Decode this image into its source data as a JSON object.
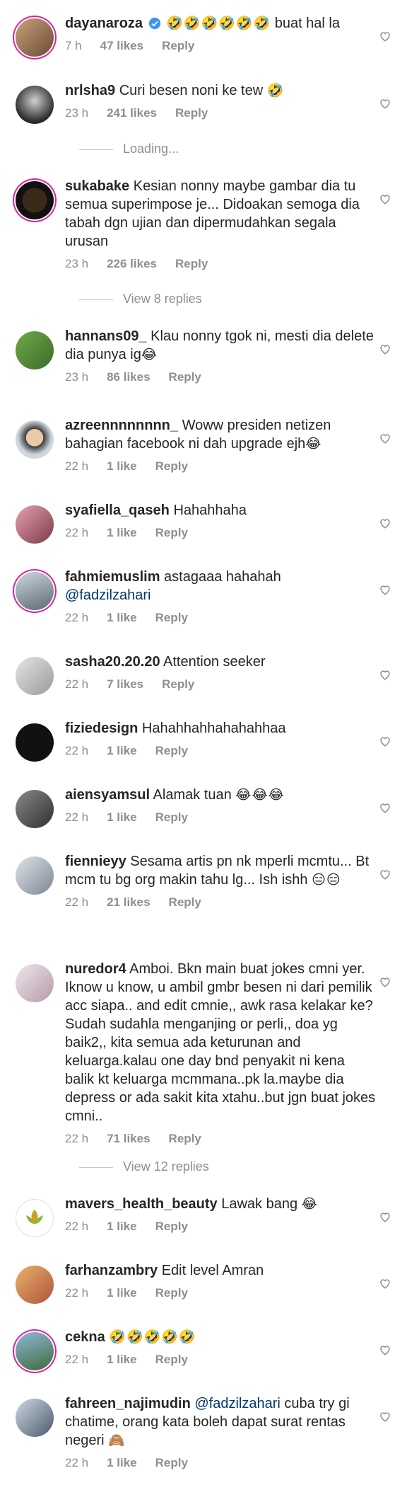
{
  "comments": [
    {
      "user": "dayanaroza",
      "text": "buat hal la",
      "emoji": "🤣🤣🤣🤣🤣🤣",
      "emoji_first": true,
      "time": "7 h",
      "likes": "47 likes",
      "reply": "Reply",
      "verified": true
    },
    {
      "user": "nrlsha9",
      "text": "Curi besen noni ke tew",
      "emoji": "🤣",
      "time": "23 h",
      "likes": "241 likes",
      "reply": "Reply"
    },
    {
      "user": "sukabake",
      "text": "Kesian nonny maybe gambar dia tu semua superimpose je... Didoakan semoga dia tabah dgn ujian dan dipermudahkan segala urusan",
      "time": "23 h",
      "likes": "226 likes",
      "reply": "Reply"
    },
    {
      "user": "hannans09_",
      "text": "Klau nonny tgok ni, mesti dia delete dia punya ig",
      "emoji": "😂",
      "time": "23 h",
      "likes": "86 likes",
      "reply": "Reply"
    },
    {
      "user": "azreennnnnnnn_",
      "text": "Woww presiden netizen bahagian facebook ni dah upgrade ejh",
      "emoji": "😂",
      "time": "22 h",
      "likes": "1 like",
      "reply": "Reply"
    },
    {
      "user": "syafiella_qaseh",
      "text": "Hahahhaha",
      "time": "22 h",
      "likes": "1 like",
      "reply": "Reply"
    },
    {
      "user": "fahmiemuslim",
      "text": "astagaaa hahahah",
      "mention": "@fadzilzahari",
      "time": "22 h",
      "likes": "1 like",
      "reply": "Reply"
    },
    {
      "user": "sasha20.20.20",
      "text": "Attention seeker",
      "time": "22 h",
      "likes": "7 likes",
      "reply": "Reply"
    },
    {
      "user": "fiziedesign",
      "text": "Hahahhahhahahahhaa",
      "time": "22 h",
      "likes": "1 like",
      "reply": "Reply"
    },
    {
      "user": "aiensyamsul",
      "text": "Alamak tuan",
      "emoji": "😂😂😂",
      "time": "22 h",
      "likes": "1 like",
      "reply": "Reply"
    },
    {
      "user": "fiennieyy",
      "text": "Sesama artis pn nk mperli mcmtu... Bt mcm tu bg org makin tahu lg... Ish ishh",
      "emoji": "😑😑",
      "time": "22 h",
      "likes": "21 likes",
      "reply": "Reply"
    },
    {
      "user": "nuredor4",
      "text": "Amboi. Bkn main buat jokes cmni yer. Iknow u know, u ambil gmbr besen ni dari pemilik acc siapa.. and edit cmnie,, awk rasa kelakar ke? Sudah sudahla menganjing or perli,, doa yg baik2,, kita semua ada keturunan and keluarga.kalau one day bnd penyakit ni kena balik kt keluarga mcmmana..pk la.maybe dia depress or ada sakit kita xtahu..but jgn buat jokes cmni..",
      "time": "22 h",
      "likes": "71 likes",
      "reply": "Reply"
    },
    {
      "user": "mavers_health_beauty",
      "text": "Lawak bang",
      "emoji": "😂",
      "time": "22 h",
      "likes": "1 like",
      "reply": "Reply"
    },
    {
      "user": "farhanzambry",
      "text": "Edit level Amran",
      "time": "22 h",
      "likes": "1 like",
      "reply": "Reply"
    },
    {
      "user": "cekna",
      "text": "",
      "emoji": "🤣🤣🤣🤣🤣",
      "time": "22 h",
      "likes": "1 like",
      "reply": "Reply"
    },
    {
      "user": "fahreen_najimudin",
      "text": "cuba try gi chatime, orang kata boleh dapat surat rentas negeri",
      "mention_first": "@fadzilzahari",
      "emoji": "🙈",
      "time": "22 h",
      "likes": "1 like",
      "reply": "Reply"
    }
  ],
  "threads": {
    "loading": "Loading...",
    "view8": "View 8 replies",
    "view12": "View 12 replies"
  },
  "colors": {
    "text": "#262626",
    "meta": "#8e8e8e",
    "mention": "#00376b",
    "story_ring": "#d6249f",
    "verified": "#3897f0"
  },
  "icons": {
    "like": "heart-outline-icon",
    "verified": "verified-badge-icon"
  }
}
